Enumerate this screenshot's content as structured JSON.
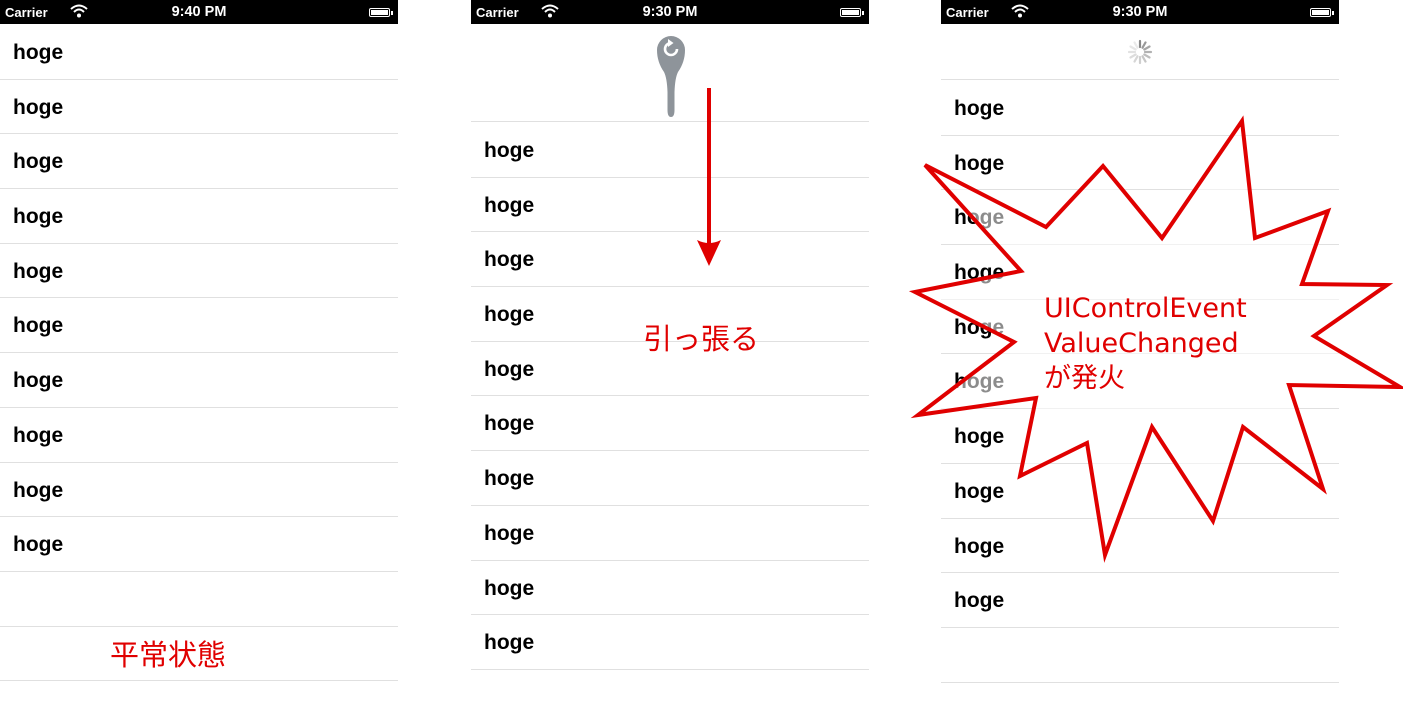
{
  "screens": [
    {
      "status": {
        "carrier": "Carrier",
        "time": "9:40 PM"
      },
      "rows": [
        "hoge",
        "hoge",
        "hoge",
        "hoge",
        "hoge",
        "hoge",
        "hoge",
        "hoge",
        "hoge",
        "hoge"
      ],
      "caption": "平常状態"
    },
    {
      "status": {
        "carrier": "Carrier",
        "time": "9:30 PM"
      },
      "rows": [
        "hoge",
        "hoge",
        "hoge",
        "hoge",
        "hoge",
        "hoge",
        "hoge",
        "hoge",
        "hoge",
        "hoge"
      ],
      "caption": "引っ張る"
    },
    {
      "status": {
        "carrier": "Carrier",
        "time": "9:30 PM"
      },
      "rows": [
        "hoge",
        "hoge",
        "hoge",
        "hoge",
        "hoge",
        "hoge",
        "hoge",
        "hoge",
        "hoge",
        "hoge"
      ],
      "burst_lines": [
        "UIControlEvent",
        "ValueChanged",
        "が発火"
      ]
    }
  ],
  "colors": {
    "annotation": "#e00000",
    "refresh_control": "#8e949a",
    "separator": "#e0e0e0"
  },
  "icons": {
    "wifi": "wifi-icon",
    "battery": "battery-icon",
    "refresh": "refresh-control-icon",
    "spinner": "activity-spinner-icon"
  }
}
